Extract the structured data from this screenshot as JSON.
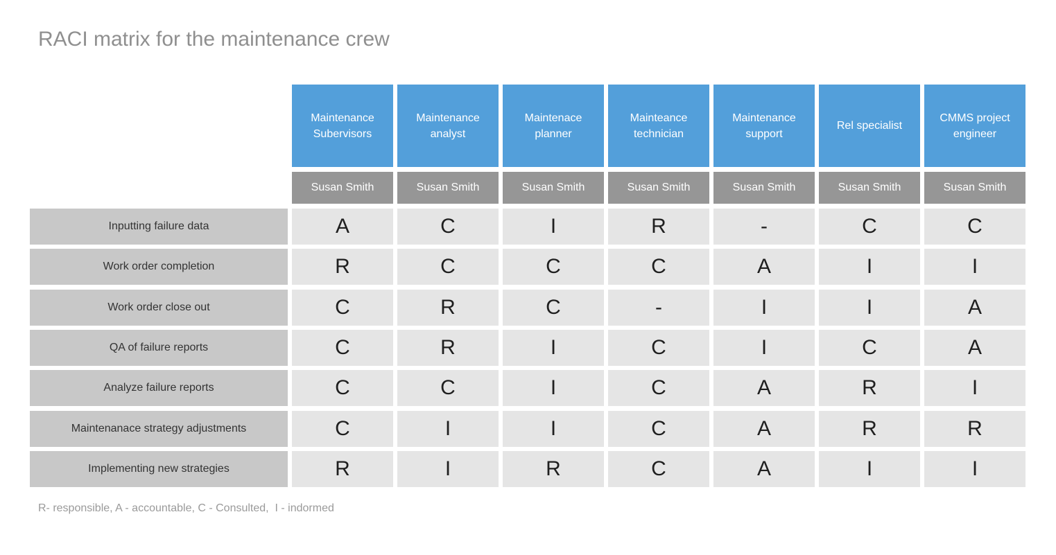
{
  "title": "RACI matrix for the maintenance crew",
  "roles": [
    {
      "title": "Maintenance Subervisors",
      "person": "Susan Smith"
    },
    {
      "title": "Maintenance analyst",
      "person": "Susan Smith"
    },
    {
      "title": "Maintenace planner",
      "person": "Susan Smith"
    },
    {
      "title": "Mainteance technician",
      "person": "Susan Smith"
    },
    {
      "title": "Maintenance support",
      "person": "Susan Smith"
    },
    {
      "title": "Rel specialist",
      "person": "Susan Smith"
    },
    {
      "title": "CMMS project engineer",
      "person": "Susan Smith"
    }
  ],
  "tasks": [
    {
      "label": "Inputting failure data",
      "values": [
        "A",
        "C",
        "I",
        "R",
        "-",
        "C",
        "C"
      ]
    },
    {
      "label": "Work order completion",
      "values": [
        "R",
        "C",
        "C",
        "C",
        "A",
        "I",
        "I"
      ]
    },
    {
      "label": "Work order close out",
      "values": [
        "C",
        "R",
        "C",
        "-",
        "I",
        "I",
        "A"
      ]
    },
    {
      "label": "QA of failure reports",
      "values": [
        "C",
        "R",
        "I",
        "C",
        "I",
        "C",
        "A"
      ]
    },
    {
      "label": "Analyze failure reports",
      "values": [
        "C",
        "C",
        "I",
        "C",
        "A",
        "R",
        "I"
      ]
    },
    {
      "label": "Maintenanace strategy adjustments",
      "values": [
        "C",
        "I",
        "I",
        "C",
        "A",
        "R",
        "R"
      ]
    },
    {
      "label": "Implementing new strategies",
      "values": [
        "R",
        "I",
        "R",
        "C",
        "A",
        "I",
        "I"
      ]
    }
  ],
  "legend": "R- responsible, A - accountable, C - Consulted,  I - indormed",
  "colors": {
    "header_blue": "#539fda",
    "name_gray": "#969696",
    "label_gray": "#c8c8c8",
    "cell_gray": "#e5e5e5"
  }
}
